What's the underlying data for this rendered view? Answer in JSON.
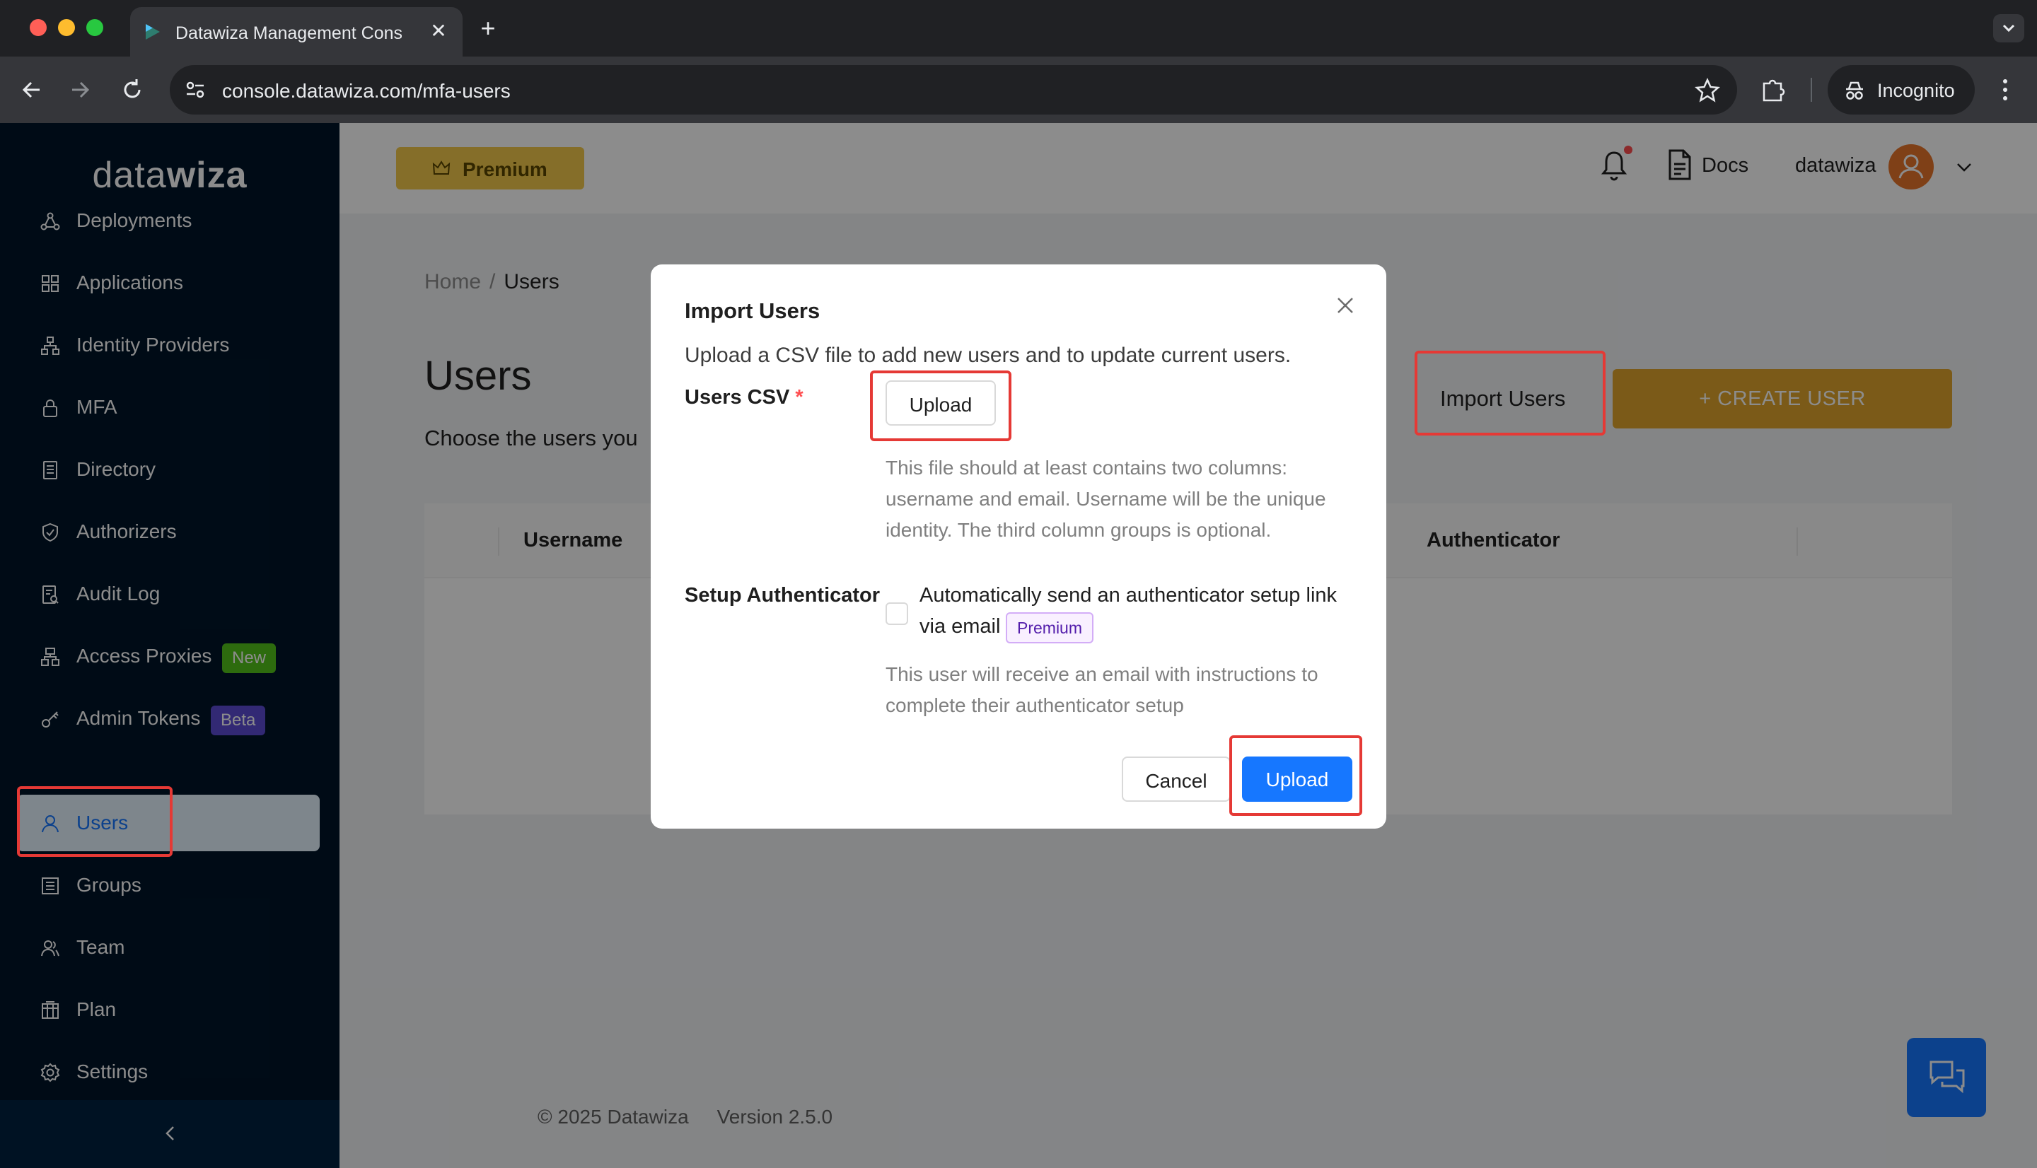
{
  "browser": {
    "tab_title": "Datawiza Management Console",
    "tab_close": "✕",
    "new_tab": "+",
    "url": "console.datawiza.com/mfa-users",
    "incognito_label": "Incognito"
  },
  "header": {
    "premium_label": "Premium",
    "docs_label": "Docs",
    "user_name": "datawiza"
  },
  "sidebar": {
    "logo_light": "data",
    "logo_bold": "wiza",
    "items": [
      {
        "label": "Deployments",
        "icon": "deployments-icon"
      },
      {
        "label": "Applications",
        "icon": "grid-icon"
      },
      {
        "label": "Identity Providers",
        "icon": "org-icon"
      },
      {
        "label": "MFA",
        "icon": "lock-icon"
      },
      {
        "label": "Directory",
        "icon": "book-icon"
      },
      {
        "label": "Authorizers",
        "icon": "shield-icon"
      },
      {
        "label": "Audit Log",
        "icon": "audit-icon"
      },
      {
        "label": "Access Proxies",
        "icon": "cluster-icon",
        "tag": "New"
      },
      {
        "label": "Admin Tokens",
        "icon": "key-icon",
        "tag": "Beta"
      },
      {
        "label": "Users",
        "icon": "user-icon",
        "active": true
      },
      {
        "label": "Groups",
        "icon": "list-icon"
      },
      {
        "label": "Team",
        "icon": "team-icon"
      },
      {
        "label": "Plan",
        "icon": "plan-icon"
      },
      {
        "label": "Settings",
        "icon": "gear-icon"
      }
    ]
  },
  "breadcrumb": {
    "home": "Home",
    "separator": "/",
    "current": "Users"
  },
  "page": {
    "title": "Users",
    "description": "Choose the users you",
    "import_button": "Import Users",
    "create_button": "+ CREATE USER"
  },
  "table": {
    "columns": [
      "Username",
      "Authenticator"
    ]
  },
  "footer": {
    "copyright": "© 2025 Datawiza",
    "version": "Version 2.5.0"
  },
  "modal": {
    "title": "Import Users",
    "subtitle": "Upload a CSV file to add new users and to update current users.",
    "csv_label": "Users CSV",
    "required_mark": "*",
    "upload_button": "Upload",
    "csv_help": "This file should at least contains two columns: username and email. Username will be the unique identity. The third column groups is optional.",
    "auth_label": "Setup Authenticator",
    "auth_checkbox_line1": "Automatically send an authenticator setup link",
    "auth_checkbox_line2": "via email",
    "premium_tag": "Premium",
    "auth_help": "This user will receive an email with instructions to complete their authenticator setup",
    "cancel_button": "Cancel",
    "submit_button": "Upload"
  },
  "colors": {
    "sidebar_bg": "#001529",
    "primary": "#1677ff",
    "create_button": "#e0a52c",
    "premium_button": "#f2c94c",
    "annotation": "#e53935"
  }
}
